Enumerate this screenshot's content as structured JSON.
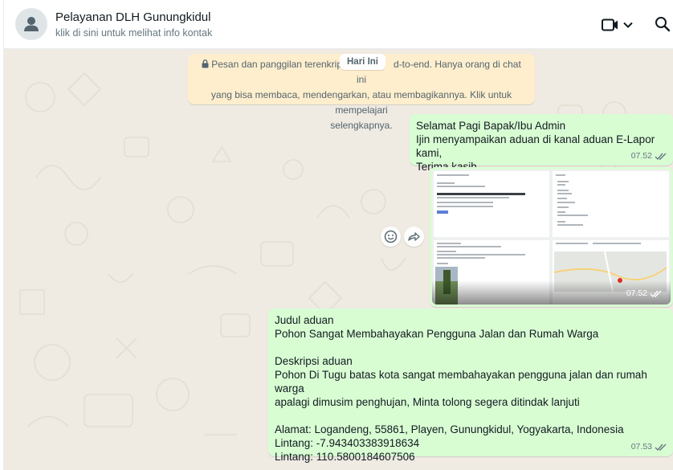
{
  "header": {
    "contact_name": "Pelayanan DLH Gunungkidul",
    "subtitle": "klik di sini untuk melihat info kontak",
    "icons": [
      "default-avatar-icon",
      "video-call-icon",
      "chevron-down-icon",
      "search-icon"
    ]
  },
  "system_note": {
    "line1_before": "Pesan dan panggilan terenkrip",
    "line1_after": "d-to-end. Hanya orang di chat ini",
    "line2": "yang bisa membaca, mendengarkan, atau membagikannya. Klik untuk mempelajari",
    "line3": "selengkapnya."
  },
  "date_chip": "Hari Ini",
  "messages": [
    {
      "type": "text",
      "text": "Selamat Pagi Bapak/Ibu Admin\nIjin menyampaikan aduan di kanal aduan E-Lapor kami,\nTerima kasih",
      "time": "07.52",
      "status": "read"
    },
    {
      "type": "image",
      "time": "07.52",
      "status": "read"
    },
    {
      "type": "text",
      "text": "Judul aduan\nPohon Sangat Membahayakan Pengguna Jalan dan Rumah Warga\n\nDeskripsi aduan\nPohon Di Tugu batas kota sangat membahayakan pengguna jalan dan rumah warga\napalagi dimusim penghujan, Minta tolong segera ditindak lanjuti\n\nAlamat: Logandeng, 55861, Playen, Gunungkidul, Yogyakarta, Indonesia\nLintang: -7.943403383918634\nLintang: 110.5800184607506",
      "time": "07.53",
      "status": "read"
    }
  ],
  "colors": {
    "chat_bg": "#efeae2",
    "outgoing_bubble": "#d9fdd3",
    "system_note_bg": "#ffeecd",
    "read_tick": "#667781"
  }
}
